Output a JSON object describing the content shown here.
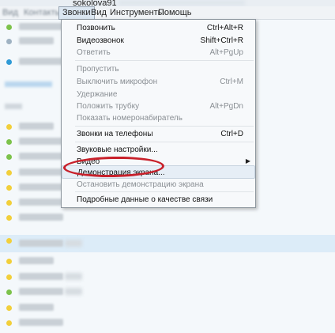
{
  "titlebar": {
    "username_fragment": "sokolova91"
  },
  "menubar": {
    "items": [
      {
        "label": "Вид",
        "blurred": true
      },
      {
        "label": "Контакты",
        "blurred": true
      },
      {
        "label": "Звонки",
        "active": true
      },
      {
        "label": "Вид"
      },
      {
        "label": "Инструменты"
      },
      {
        "label": "Помощь"
      }
    ]
  },
  "dropdown": {
    "items": [
      {
        "label": "Позвонить",
        "shortcut": "Ctrl+Alt+R",
        "enabled": true
      },
      {
        "label": "Видеозвонок",
        "shortcut": "Shift+Ctrl+R",
        "enabled": true
      },
      {
        "label": "Ответить",
        "shortcut": "Alt+PgUp",
        "enabled": false
      },
      {
        "label": "Пропустить",
        "shortcut": "",
        "enabled": false
      },
      {
        "label": "Выключить микрофон",
        "shortcut": "Ctrl+M",
        "enabled": false
      },
      {
        "label": "Удержание",
        "shortcut": "",
        "enabled": false
      },
      {
        "label": "Положить трубку",
        "shortcut": "Alt+PgDn",
        "enabled": false
      },
      {
        "label": "Показать номеронабиратель",
        "shortcut": "",
        "enabled": false
      },
      {
        "label": "Звонки на телефоны",
        "shortcut": "Ctrl+D",
        "enabled": true
      },
      {
        "label": "Звуковые настройки...",
        "shortcut": "",
        "enabled": true
      },
      {
        "label": "Видео",
        "shortcut": "",
        "enabled": true,
        "submenu": true
      },
      {
        "label": "Демонстрация экрана...",
        "shortcut": "",
        "enabled": true,
        "highlighted": true
      },
      {
        "label": "Остановить демонстрацию экрана",
        "shortcut": "",
        "enabled": false
      },
      {
        "label": "Подробные данные о качестве связи",
        "shortcut": "",
        "enabled": true
      }
    ]
  },
  "colors": {
    "annotation_red": "#c8202a",
    "highlight_row": "#dcecf8",
    "status_green": "#7cc24a",
    "status_yellow": "#f2cf3a"
  }
}
